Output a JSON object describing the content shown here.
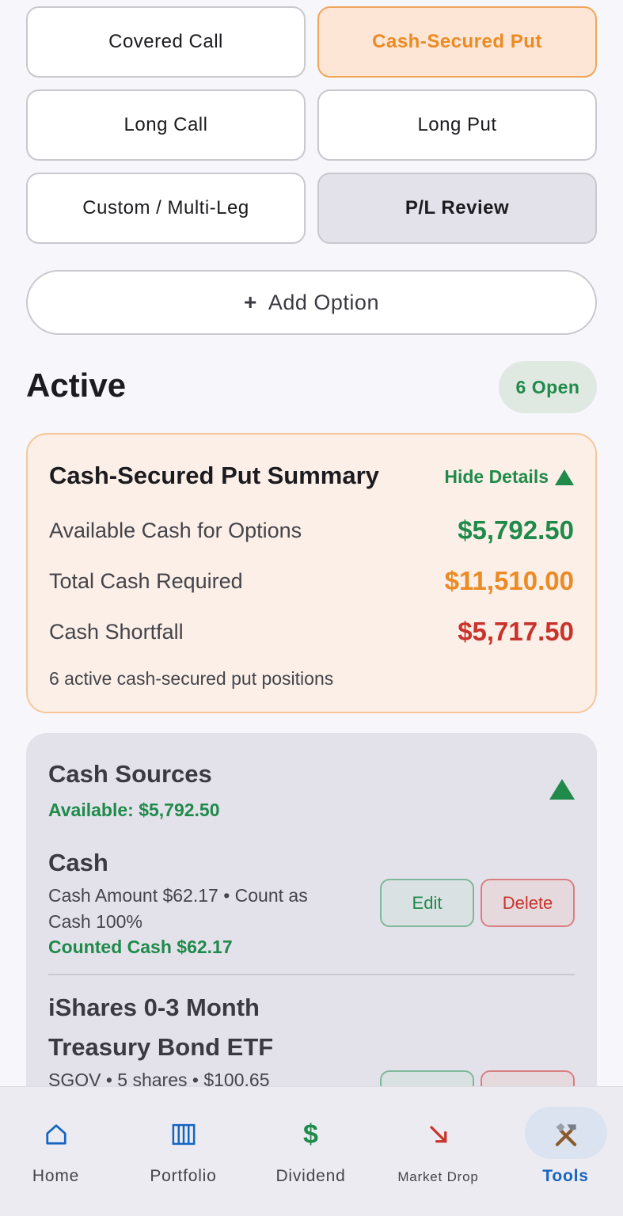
{
  "strategy_types": [
    {
      "label": "Covered Call",
      "state": "default"
    },
    {
      "label": "Cash-Secured Put",
      "state": "selected"
    },
    {
      "label": "Long Call",
      "state": "default"
    },
    {
      "label": "Long Put",
      "state": "default"
    },
    {
      "label": "Custom / Multi-Leg",
      "state": "default"
    },
    {
      "label": "P/L Review",
      "state": "review"
    }
  ],
  "add_option": {
    "icon": "+",
    "label": "Add Option"
  },
  "active": {
    "title": "Active",
    "badge": "6 Open"
  },
  "summary": {
    "title": "Cash-Secured Put Summary",
    "toggle_label": "Hide Details",
    "rows": [
      {
        "label": "Available Cash for Options",
        "value": "$5,792.50",
        "color": "#1f8a4a"
      },
      {
        "label": "Total Cash Required",
        "value": "$11,510.00",
        "color": "#ec8a23"
      },
      {
        "label": "Cash Shortfall",
        "value": "$5,717.50",
        "color": "#c8342c"
      }
    ],
    "note": "6 active cash-secured put positions"
  },
  "cash_sources": {
    "title": "Cash Sources",
    "available": "Available: $5,792.50",
    "items": [
      {
        "name": "Cash",
        "detail": "Cash Amount $62.17 • Count as Cash 100%",
        "counted": "Counted Cash $62.17",
        "edit_label": "Edit",
        "delete_label": "Delete"
      },
      {
        "name": "iShares 0-3 Month Treasury Bond ETF",
        "detail": "SGOV • 5 shares • $100.65"
      }
    ]
  },
  "bottom_nav": [
    {
      "label": "Home",
      "icon": "home-icon",
      "active": false
    },
    {
      "label": "Portfolio",
      "icon": "portfolio-icon",
      "active": false
    },
    {
      "label": "Dividend",
      "icon": "dollar-icon",
      "active": false
    },
    {
      "label": "Market Drop",
      "icon": "trend-down-icon",
      "active": false
    },
    {
      "label": "Tools",
      "icon": "tools-icon",
      "active": true
    }
  ],
  "colors": {
    "accent_orange": "#ec8a23",
    "green": "#1f8a4a",
    "red": "#c8342c",
    "nav_active": "#1565c0"
  }
}
